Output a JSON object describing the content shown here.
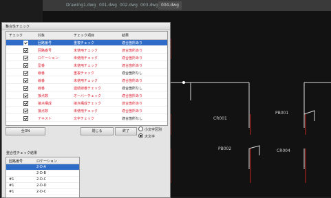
{
  "cad_tabs": [
    "Drawing1.dwg",
    "001.dwg",
    "002.dwg",
    "003.dwg",
    "004.dwg"
  ],
  "cad_labels": [
    "CR001",
    "PB001",
    "PB002",
    "CR004"
  ],
  "dialog": {
    "title": "整合性チェック",
    "close": "×",
    "headers": {
      "check": "チェック",
      "name": "対象",
      "item": "チェック項目",
      "result": "結果"
    },
    "rows": [
      {
        "checked": true,
        "name": "回路番号",
        "item": "重複チェック",
        "result": "適合箇所あり",
        "selected": true,
        "ok": false
      },
      {
        "checked": true,
        "name": "回路番号",
        "item": "未使用チェック",
        "result": "適合箇所あり",
        "ok": false
      },
      {
        "checked": true,
        "name": "ロケーション",
        "item": "未使用チェック",
        "result": "適合箇所あり",
        "ok": false
      },
      {
        "checked": true,
        "name": "型番",
        "item": "未使用チェック",
        "result": "適合箇所あり",
        "ok": false
      },
      {
        "checked": true,
        "name": "線番",
        "item": "重複チェック",
        "result": "適合箇所なし",
        "ok": true
      },
      {
        "checked": true,
        "name": "線番",
        "item": "未使用チェック",
        "result": "適合箇所あり",
        "ok": false
      },
      {
        "checked": true,
        "name": "線番",
        "item": "連続線番チェック",
        "result": "適合箇所なし",
        "ok": true
      },
      {
        "checked": true,
        "name": "接点数",
        "item": "オーバーチェック",
        "result": "適合箇所あり",
        "ok": false
      },
      {
        "checked": true,
        "name": "接点構成",
        "item": "接点構成チェック",
        "result": "適合箇所あり",
        "ok": false
      },
      {
        "checked": true,
        "name": "接点数",
        "item": "未使用チェック",
        "result": "適合箇所あり",
        "ok": false
      },
      {
        "checked": true,
        "name": "テキスト",
        "item": "文字チェック",
        "result": "適合箇所なし",
        "ok": true
      }
    ],
    "buttons": {
      "all": "全ON",
      "close": "閉じる",
      "exec": "終了"
    },
    "radios": {
      "opt1": "小文字区別",
      "opt2": "大文字"
    },
    "result_label": "整合性チェック結果",
    "result_headers": {
      "a": "回路番号",
      "b": "ロケーション"
    },
    "result_rows": [
      {
        "a": "",
        "b": "2-D-A",
        "selected": true
      },
      {
        "a": "",
        "b": "2-D-B"
      },
      {
        "a": "#1",
        "b": "2-D-C"
      },
      {
        "a": "#1",
        "b": "2-D-D"
      },
      {
        "a": "#1",
        "b": "2-D-C"
      }
    ]
  }
}
